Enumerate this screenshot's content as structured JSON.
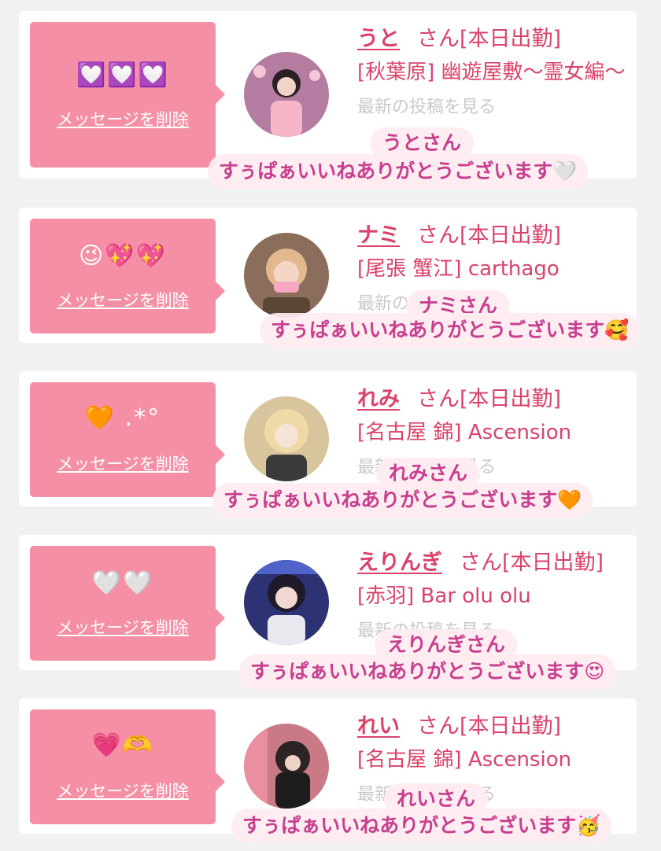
{
  "common": {
    "delete_label": "メッセージを削除",
    "honorific": "さん[本日出勤]"
  },
  "cards": [
    {
      "name": "うと",
      "store": "[秋葉原] 幽遊屋敷〜霊女編〜",
      "faded": "最新の投稿を見る",
      "emoji": "💟💟💟",
      "caption_name": "うとさん",
      "caption_thanks": "すぅぱぁいいねありがとうございます🤍",
      "avatar_color": "#b37ca0"
    },
    {
      "name": "ナミ",
      "store": "[尾張 蟹江] carthago",
      "faded": "最新の投稿を見る",
      "emoji": "😉💖💖",
      "caption_name": "ナミさん",
      "caption_thanks": "すぅぱぁいいねありがとうございます🥰",
      "avatar_color": "#8a6d5a"
    },
    {
      "name": "れみ",
      "store": "[名古屋 錦] Ascension",
      "faded": "最新の投稿を見る",
      "emoji": "🧡 .*°",
      "caption_name": "れみさん",
      "caption_thanks": "すぅぱぁいいねありがとうございます🧡",
      "avatar_color": "#d8c59e"
    },
    {
      "name": "えりんぎ",
      "store": "[赤羽] Bar olu olu",
      "faded": "最新の投稿を見る",
      "emoji": "🤍🤍",
      "caption_name": "えりんぎさん",
      "caption_thanks": "すぅぱぁいいねありがとうございます😍",
      "avatar_color": "#3b3f8f"
    },
    {
      "name": "れい",
      "store": "[名古屋 錦] Ascension",
      "faded": "最新の投稿を見る",
      "emoji": "💗🫶",
      "caption_name": "れいさん",
      "caption_thanks": "すぅぱぁいいねありがとうございます🥳",
      "avatar_color": "#c97a86"
    }
  ]
}
